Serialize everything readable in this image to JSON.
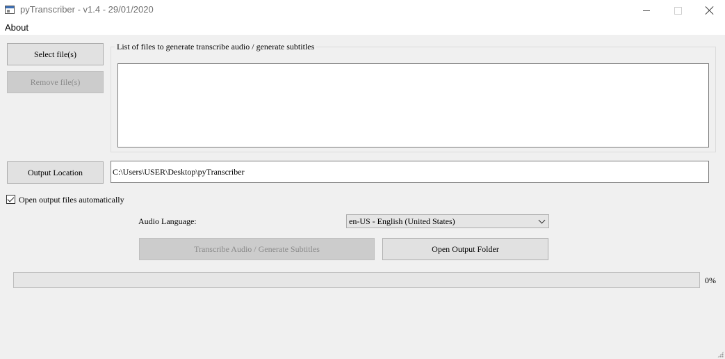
{
  "window": {
    "title": "pyTranscriber - v1.4 - 29/01/2020",
    "minimize_icon": "minimize-icon",
    "maximize_icon": "maximize-icon",
    "close_icon": "close-icon"
  },
  "menu": {
    "about": "About"
  },
  "buttons": {
    "select_files": "Select file(s)",
    "remove_files": "Remove file(s)",
    "output_location": "Output Location",
    "transcribe": "Transcribe Audio / Generate Subtitles",
    "open_output_folder": "Open Output Folder"
  },
  "file_list": {
    "title": "List of files to generate transcribe audio / generate subtitles",
    "items": []
  },
  "output": {
    "path": "C:\\Users\\USER\\Desktop\\pyTranscriber"
  },
  "options": {
    "open_output_automatically": "Open output files automatically",
    "open_output_checked": true
  },
  "language": {
    "label": "Audio Language:",
    "selected": "en-US - English (United States)"
  },
  "progress": {
    "value": 0,
    "label": "0%",
    "color": "#06b025"
  }
}
